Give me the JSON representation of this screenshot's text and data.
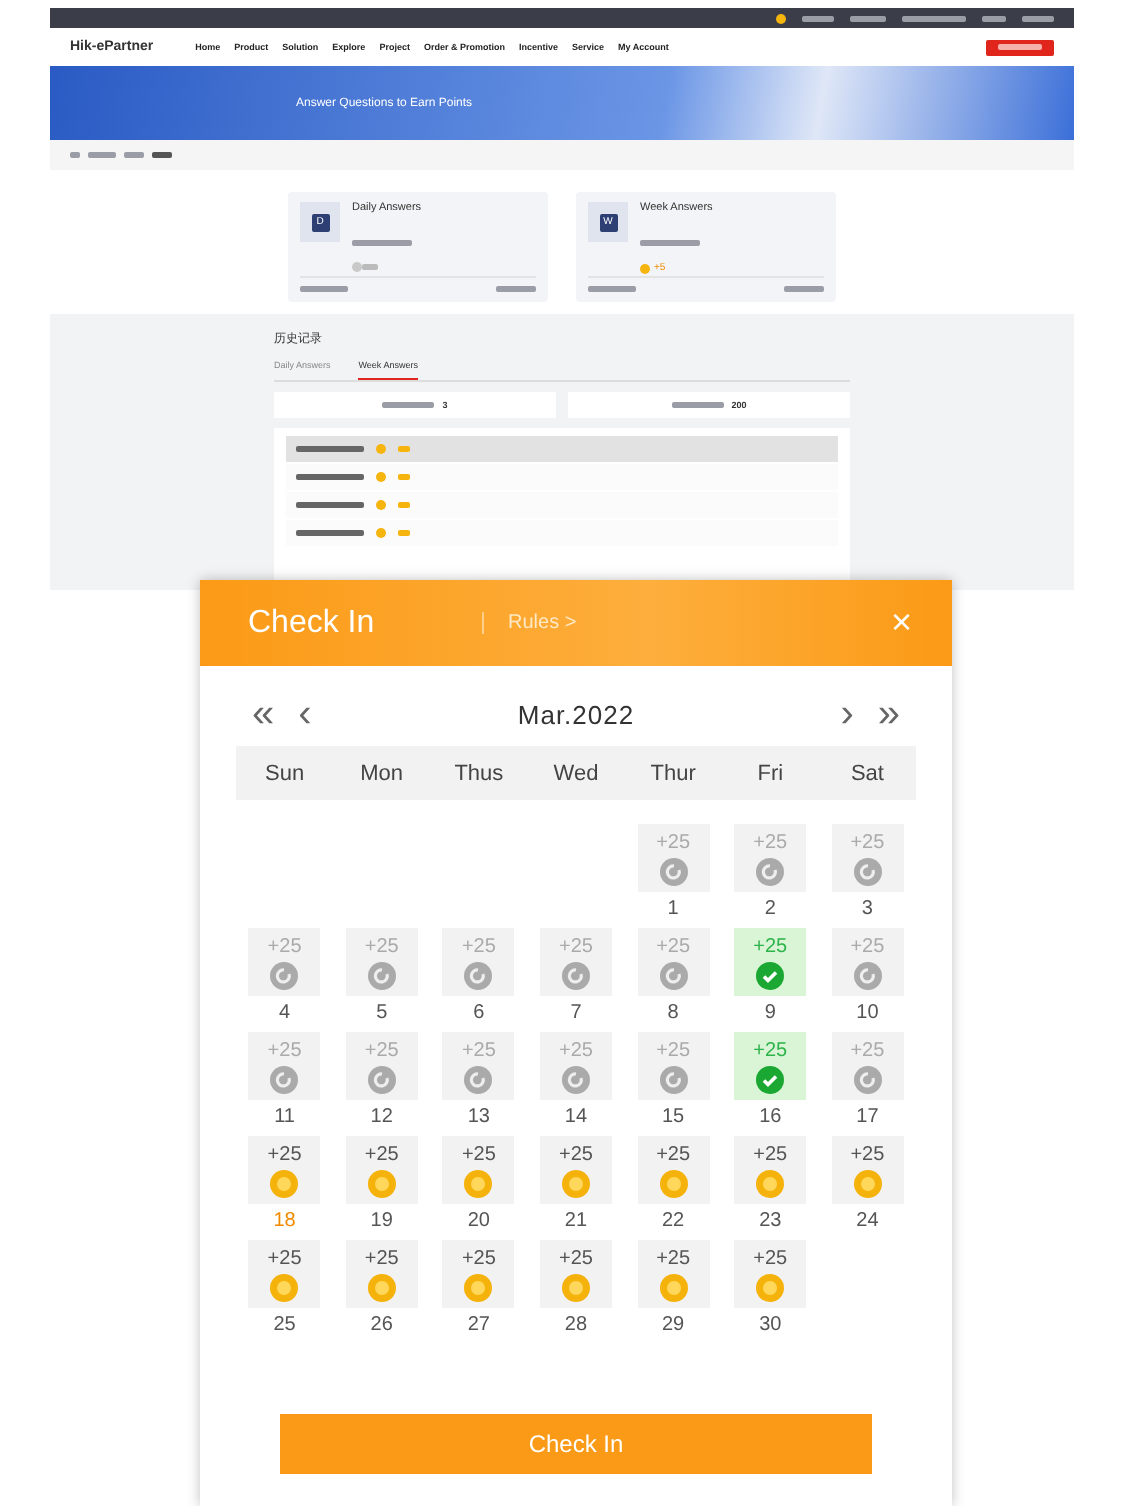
{
  "brand": "Hik-ePartner",
  "nav": [
    "Home",
    "Product",
    "Solution",
    "Explore",
    "Project",
    "Order & Promotion",
    "Incentive",
    "Service",
    "My Account"
  ],
  "banner": {
    "title": "Answer Questions to Earn Points"
  },
  "cards": [
    {
      "title": "Daily Answers",
      "letter": "D",
      "earned": false
    },
    {
      "title": "Week Answers",
      "letter": "W",
      "reward": "+5",
      "earned": true
    }
  ],
  "history": {
    "title": "历史记录",
    "tabs": [
      {
        "label": "Daily Answers",
        "selected": false
      },
      {
        "label": "Week Answers",
        "selected": true
      }
    ],
    "stats": [
      "3",
      "200"
    ],
    "rows": [
      {
        "selected": true
      },
      {
        "selected": false
      },
      {
        "selected": false
      },
      {
        "selected": false
      }
    ]
  },
  "checkin": {
    "title": "Check In",
    "rules": "Rules >",
    "close": "×",
    "prev_year": "«",
    "prev": "‹",
    "month": "Mar.2022",
    "next": "›",
    "next_year": "»",
    "weekdays": [
      "Sun",
      "Mon",
      "Thus",
      "Wed",
      "Thur",
      "Fri",
      "Sat"
    ],
    "days": [
      {
        "day": "1",
        "points": "+25",
        "kind": "missed",
        "today": false
      },
      {
        "day": "2",
        "points": "+25",
        "kind": "missed",
        "today": false
      },
      {
        "day": "3",
        "points": "+25",
        "kind": "missed",
        "today": false
      },
      {
        "day": "4",
        "points": "+25",
        "kind": "missed",
        "today": false
      },
      {
        "day": "5",
        "points": "+25",
        "kind": "missed",
        "today": false
      },
      {
        "day": "6",
        "points": "+25",
        "kind": "missed",
        "today": false
      },
      {
        "day": "7",
        "points": "+25",
        "kind": "missed",
        "today": false
      },
      {
        "day": "8",
        "points": "+25",
        "kind": "missed",
        "today": false
      },
      {
        "day": "9",
        "points": "+25",
        "kind": "checked",
        "today": false
      },
      {
        "day": "10",
        "points": "+25",
        "kind": "missed",
        "today": false
      },
      {
        "day": "11",
        "points": "+25",
        "kind": "missed",
        "today": false
      },
      {
        "day": "12",
        "points": "+25",
        "kind": "missed",
        "today": false
      },
      {
        "day": "13",
        "points": "+25",
        "kind": "missed",
        "today": false
      },
      {
        "day": "14",
        "points": "+25",
        "kind": "missed",
        "today": false
      },
      {
        "day": "15",
        "points": "+25",
        "kind": "missed",
        "today": false
      },
      {
        "day": "16",
        "points": "+25",
        "kind": "checked",
        "today": false
      },
      {
        "day": "17",
        "points": "+25",
        "kind": "missed",
        "today": false
      },
      {
        "day": "18",
        "points": "+25",
        "kind": "upcoming",
        "today": true
      },
      {
        "day": "19",
        "points": "+25",
        "kind": "upcoming",
        "today": false
      },
      {
        "day": "20",
        "points": "+25",
        "kind": "upcoming",
        "today": false
      },
      {
        "day": "21",
        "points": "+25",
        "kind": "upcoming",
        "today": false
      },
      {
        "day": "22",
        "points": "+25",
        "kind": "upcoming",
        "today": false
      },
      {
        "day": "23",
        "points": "+25",
        "kind": "upcoming",
        "today": false
      },
      {
        "day": "24",
        "points": "+25",
        "kind": "upcoming",
        "today": false
      },
      {
        "day": "25",
        "points": "+25",
        "kind": "upcoming",
        "today": false
      },
      {
        "day": "26",
        "points": "+25",
        "kind": "upcoming",
        "today": false
      },
      {
        "day": "27",
        "points": "+25",
        "kind": "upcoming",
        "today": false
      },
      {
        "day": "28",
        "points": "+25",
        "kind": "upcoming",
        "today": false
      },
      {
        "day": "29",
        "points": "+25",
        "kind": "upcoming",
        "today": false
      },
      {
        "day": "30",
        "points": "+25",
        "kind": "upcoming",
        "today": false
      }
    ],
    "button": "Check In"
  }
}
